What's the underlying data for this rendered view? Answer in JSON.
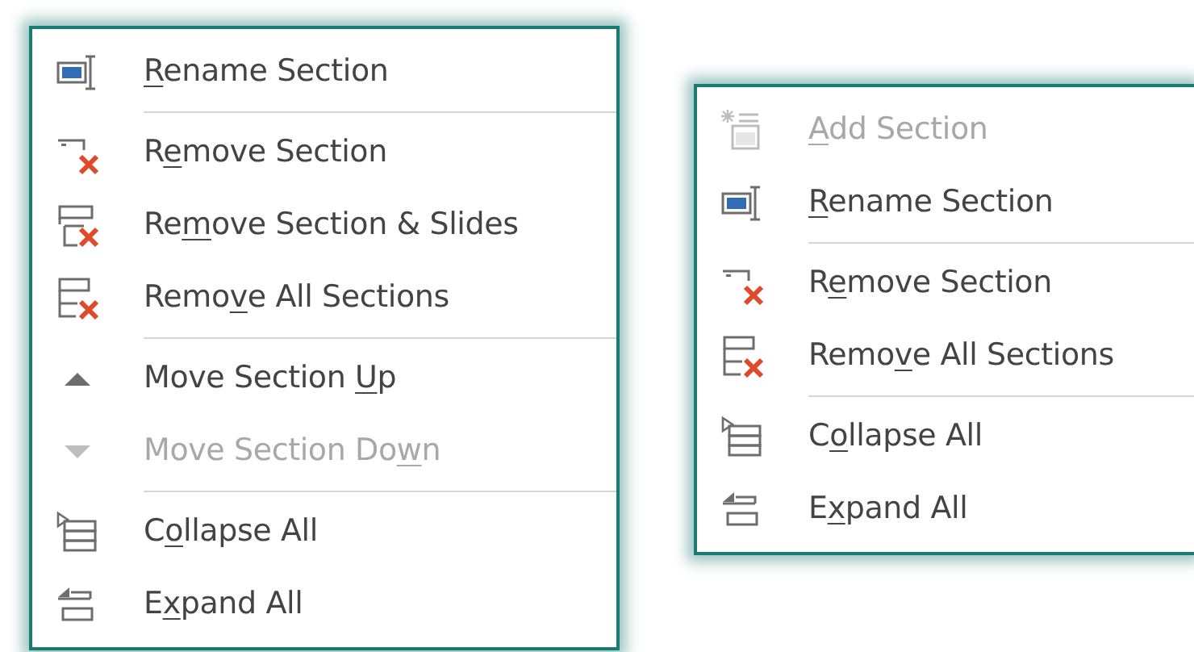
{
  "menus": [
    {
      "items": [
        {
          "kind": "rename",
          "access_key": "R",
          "label_end": "ename Section",
          "disabled": false
        },
        {
          "kind": "separator"
        },
        {
          "kind": "remove",
          "label_start": "R",
          "access_key": "e",
          "label_end": "move Section",
          "disabled": false
        },
        {
          "kind": "removeslides",
          "label_start": "Re",
          "access_key": "m",
          "label_end": "ove Section & Slides",
          "disabled": false
        },
        {
          "kind": "removeall",
          "label_start": "Remo",
          "access_key": "v",
          "label_end": "e All Sections",
          "disabled": false
        },
        {
          "kind": "separator"
        },
        {
          "kind": "up",
          "label_start": "Move Section ",
          "access_key": "U",
          "label_end": "p",
          "disabled": false
        },
        {
          "kind": "down",
          "label_start": "Move Section Do",
          "access_key": "w",
          "label_end": "n",
          "disabled": true
        },
        {
          "kind": "separator"
        },
        {
          "kind": "collapse",
          "label_start": "C",
          "access_key": "o",
          "label_end": "llapse All",
          "disabled": false
        },
        {
          "kind": "expand",
          "label_start": "E",
          "access_key": "x",
          "label_end": "pand All",
          "disabled": false
        }
      ]
    },
    {
      "items": [
        {
          "kind": "add",
          "access_key": "A",
          "label_end": "dd Section",
          "disabled": true
        },
        {
          "kind": "rename",
          "access_key": "R",
          "label_end": "ename Section",
          "disabled": false
        },
        {
          "kind": "separator"
        },
        {
          "kind": "remove",
          "label_start": "R",
          "access_key": "e",
          "label_end": "move Section",
          "disabled": false
        },
        {
          "kind": "removeall",
          "label_start": "Remo",
          "access_key": "v",
          "label_end": "e All Sections",
          "disabled": false
        },
        {
          "kind": "separator"
        },
        {
          "kind": "collapse",
          "label_start": "C",
          "access_key": "o",
          "label_end": "llapse All",
          "disabled": false
        },
        {
          "kind": "expand",
          "label_start": "E",
          "access_key": "x",
          "label_end": "pand All",
          "disabled": false
        }
      ]
    }
  ]
}
